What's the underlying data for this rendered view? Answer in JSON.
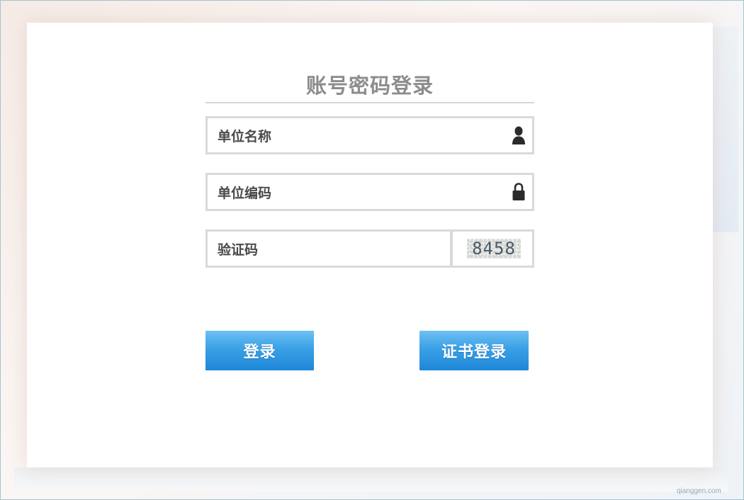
{
  "login": {
    "title": "账号密码登录",
    "fields": {
      "unit_name": {
        "placeholder": "单位名称",
        "icon": "user-icon"
      },
      "unit_code": {
        "placeholder": "单位编码",
        "icon": "lock-icon"
      },
      "captcha": {
        "placeholder": "验证码",
        "code": "8458"
      }
    },
    "buttons": {
      "login": "登录",
      "certificate_login": "证书登录"
    }
  },
  "watermark": "qianggen.com",
  "colors": {
    "button_top": "#6ec0f2",
    "button_bottom": "#1f87d8",
    "title_text": "#8c8c8c",
    "field_border": "#d9d9dd",
    "label_text": "#4a4a4a"
  }
}
